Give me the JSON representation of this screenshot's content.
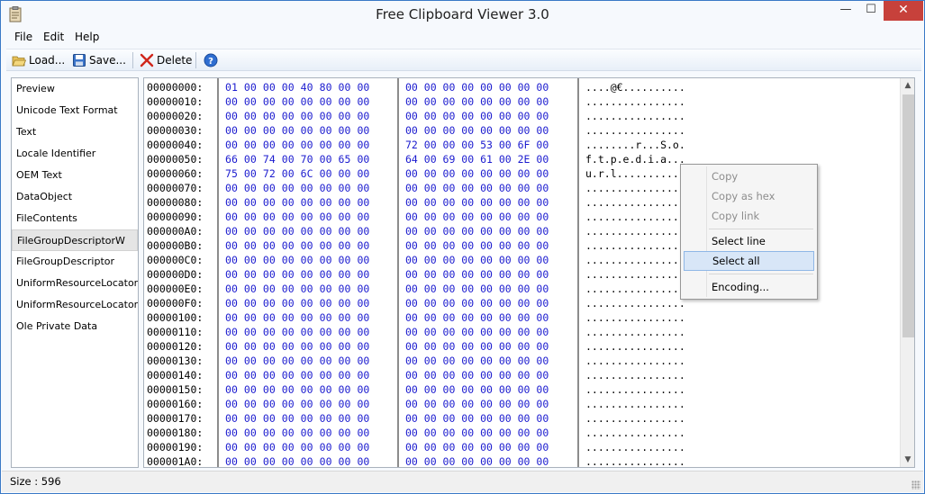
{
  "window": {
    "title": "Free Clipboard Viewer 3.0",
    "minimize_glyph": "—",
    "maximize_glyph": "☐",
    "close_glyph": "✕"
  },
  "menu": [
    "File",
    "Edit",
    "Help"
  ],
  "toolbar": {
    "load_label": "Load...",
    "save_label": "Save...",
    "delete_label": "Delete",
    "icons": [
      "folder-open-icon",
      "floppy-disk-icon",
      "delete-x-icon",
      "help-icon"
    ]
  },
  "formats": [
    "Preview",
    "Unicode Text Format",
    "Text",
    "Locale Identifier",
    "OEM Text",
    "DataObject",
    "FileContents",
    "FileGroupDescriptorW",
    "FileGroupDescriptor",
    "UniformResourceLocatorW",
    "UniformResourceLocator",
    "Ole Private Data"
  ],
  "selected_format": "FileGroupDescriptorW",
  "hex_rows": [
    {
      "addr": "00000000:",
      "hex1": "01 00 00 00 40 80 00 00",
      "hex2": "00 00 00 00 00 00 00 00",
      "ascii": "....@€.........."
    },
    {
      "addr": "00000010:",
      "hex1": "00 00 00 00 00 00 00 00",
      "hex2": "00 00 00 00 00 00 00 00",
      "ascii": "................"
    },
    {
      "addr": "00000020:",
      "hex1": "00 00 00 00 00 00 00 00",
      "hex2": "00 00 00 00 00 00 00 00",
      "ascii": "................"
    },
    {
      "addr": "00000030:",
      "hex1": "00 00 00 00 00 00 00 00",
      "hex2": "00 00 00 00 00 00 00 00",
      "ascii": "................"
    },
    {
      "addr": "00000040:",
      "hex1": "00 00 00 00 00 00 00 00",
      "hex2": "72 00 00 00 53 00 6F 00",
      "ascii": "........r...S.o."
    },
    {
      "addr": "00000050:",
      "hex1": "66 00 74 00 70 00 65 00",
      "hex2": "64 00 69 00 61 00 2E 00",
      "ascii": "f.t.p.e.d.i.a..."
    },
    {
      "addr": "00000060:",
      "hex1": "75 00 72 00 6C 00 00 00",
      "hex2": "00 00 00 00 00 00 00 00",
      "ascii": "u.r.l..........."
    },
    {
      "addr": "00000070:",
      "hex1": "00 00 00 00 00 00 00 00",
      "hex2": "00 00 00 00 00 00 00 00",
      "ascii": "................"
    },
    {
      "addr": "00000080:",
      "hex1": "00 00 00 00 00 00 00 00",
      "hex2": "00 00 00 00 00 00 00 00",
      "ascii": "................"
    },
    {
      "addr": "00000090:",
      "hex1": "00 00 00 00 00 00 00 00",
      "hex2": "00 00 00 00 00 00 00 00",
      "ascii": "................"
    },
    {
      "addr": "000000A0:",
      "hex1": "00 00 00 00 00 00 00 00",
      "hex2": "00 00 00 00 00 00 00 00",
      "ascii": "................"
    },
    {
      "addr": "000000B0:",
      "hex1": "00 00 00 00 00 00 00 00",
      "hex2": "00 00 00 00 00 00 00 00",
      "ascii": "................"
    },
    {
      "addr": "000000C0:",
      "hex1": "00 00 00 00 00 00 00 00",
      "hex2": "00 00 00 00 00 00 00 00",
      "ascii": "................"
    },
    {
      "addr": "000000D0:",
      "hex1": "00 00 00 00 00 00 00 00",
      "hex2": "00 00 00 00 00 00 00 00",
      "ascii": "................"
    },
    {
      "addr": "000000E0:",
      "hex1": "00 00 00 00 00 00 00 00",
      "hex2": "00 00 00 00 00 00 00 00",
      "ascii": "................"
    },
    {
      "addr": "000000F0:",
      "hex1": "00 00 00 00 00 00 00 00",
      "hex2": "00 00 00 00 00 00 00 00",
      "ascii": "................"
    },
    {
      "addr": "00000100:",
      "hex1": "00 00 00 00 00 00 00 00",
      "hex2": "00 00 00 00 00 00 00 00",
      "ascii": "................"
    },
    {
      "addr": "00000110:",
      "hex1": "00 00 00 00 00 00 00 00",
      "hex2": "00 00 00 00 00 00 00 00",
      "ascii": "................"
    },
    {
      "addr": "00000120:",
      "hex1": "00 00 00 00 00 00 00 00",
      "hex2": "00 00 00 00 00 00 00 00",
      "ascii": "................"
    },
    {
      "addr": "00000130:",
      "hex1": "00 00 00 00 00 00 00 00",
      "hex2": "00 00 00 00 00 00 00 00",
      "ascii": "................"
    },
    {
      "addr": "00000140:",
      "hex1": "00 00 00 00 00 00 00 00",
      "hex2": "00 00 00 00 00 00 00 00",
      "ascii": "................"
    },
    {
      "addr": "00000150:",
      "hex1": "00 00 00 00 00 00 00 00",
      "hex2": "00 00 00 00 00 00 00 00",
      "ascii": "................"
    },
    {
      "addr": "00000160:",
      "hex1": "00 00 00 00 00 00 00 00",
      "hex2": "00 00 00 00 00 00 00 00",
      "ascii": "................"
    },
    {
      "addr": "00000170:",
      "hex1": "00 00 00 00 00 00 00 00",
      "hex2": "00 00 00 00 00 00 00 00",
      "ascii": "................"
    },
    {
      "addr": "00000180:",
      "hex1": "00 00 00 00 00 00 00 00",
      "hex2": "00 00 00 00 00 00 00 00",
      "ascii": "................"
    },
    {
      "addr": "00000190:",
      "hex1": "00 00 00 00 00 00 00 00",
      "hex2": "00 00 00 00 00 00 00 00",
      "ascii": "................"
    },
    {
      "addr": "000001A0:",
      "hex1": "00 00 00 00 00 00 00 00",
      "hex2": "00 00 00 00 00 00 00 00",
      "ascii": "................"
    }
  ],
  "context_menu": {
    "items": [
      {
        "label": "Copy",
        "enabled": false
      },
      {
        "label": "Copy as hex",
        "enabled": false
      },
      {
        "label": "Copy link",
        "enabled": false
      },
      {
        "label": "Select line",
        "enabled": true
      },
      {
        "label": "Select all",
        "enabled": true,
        "highlighted": true
      },
      {
        "label": "Encoding...",
        "enabled": true
      }
    ]
  },
  "status": {
    "size_text": "Size : 596"
  },
  "colors": {
    "accent_border": "#3a79c6",
    "close_button": "#c7413b",
    "hex_text": "#1b1bcf",
    "menu_highlight": "#d8e6f7"
  }
}
